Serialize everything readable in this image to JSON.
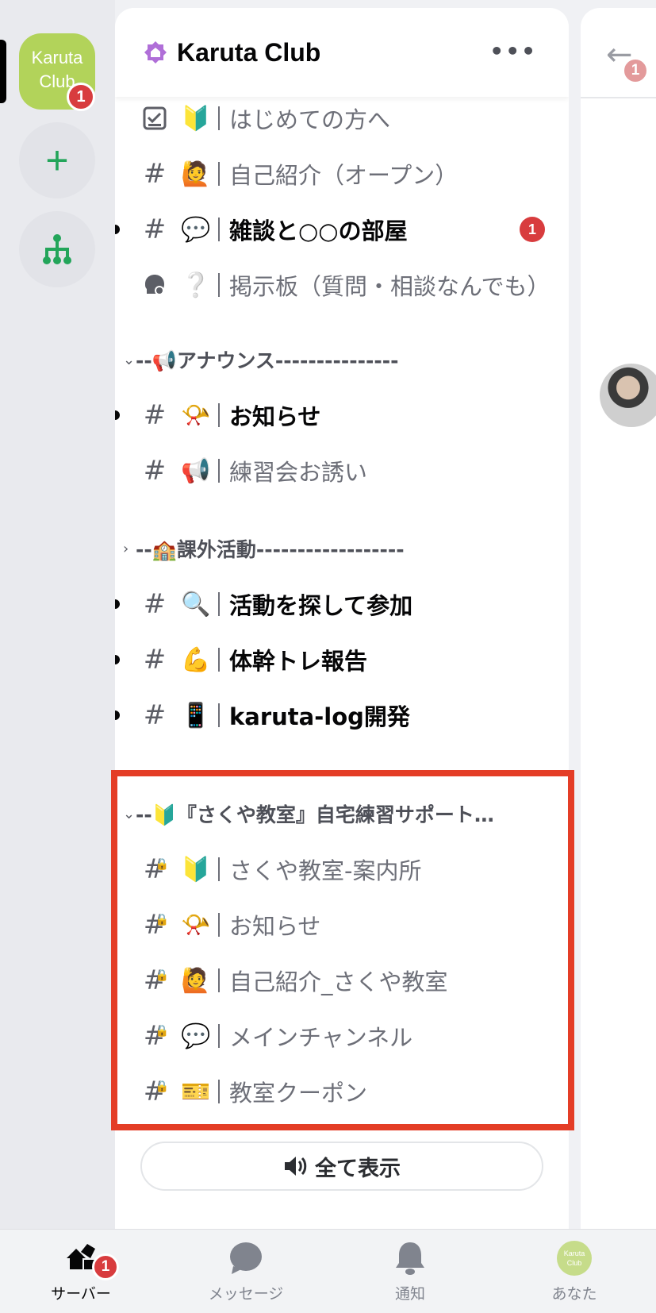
{
  "server_rail": {
    "server_icon_text": "Karuta Club",
    "server_badge": "1",
    "add_icon": "plus-icon",
    "directory_icon": "hub-icon"
  },
  "header": {
    "title": "Karuta Club",
    "more_label": "•••"
  },
  "channels_top": [
    {
      "icon": "checklist",
      "emoji": "🔰",
      "name": "はじめての方へ",
      "unread": false,
      "badge": ""
    },
    {
      "icon": "#",
      "emoji": "🙋",
      "name": "自己紹介（オープン）",
      "unread": false,
      "badge": ""
    },
    {
      "icon": "#",
      "emoji": "💬",
      "name": "雑談と○○の部屋",
      "unread": true,
      "badge": "1"
    },
    {
      "icon": "forum",
      "emoji": "❔",
      "name": "掲示板（質問・相談なんでも）",
      "unread": false,
      "badge": ""
    }
  ],
  "categories": [
    {
      "name": "--📢アナウンス---------------",
      "chevron": "⌄"
    },
    {
      "name": "--🏫課外活動------------------",
      "chevron": "›"
    },
    {
      "name": "--🔰『さくや教室』自宅練習サポートコミュニティ",
      "chevron": "⌄"
    }
  ],
  "announce_channels": [
    {
      "icon": "#",
      "emoji": "📯",
      "name": "お知らせ",
      "unread": true
    },
    {
      "icon": "#",
      "emoji": "📢",
      "name": "練習会お誘い",
      "unread": false
    }
  ],
  "activity_channels": [
    {
      "icon": "#",
      "emoji": "🔍",
      "name": "活動を探して参加",
      "unread": true
    },
    {
      "icon": "#",
      "emoji": "💪",
      "name": "体幹トレ報告",
      "unread": true
    },
    {
      "icon": "#",
      "emoji": "📱",
      "name": "karuta-log開発",
      "unread": true
    }
  ],
  "sakuya_channels": [
    {
      "icon": "#🔒",
      "emoji": "🔰",
      "name": "さくや教室-案内所"
    },
    {
      "icon": "#🔒",
      "emoji": "📯",
      "name": "お知らせ"
    },
    {
      "icon": "#🔒",
      "emoji": "🙋",
      "name": "自己紹介_さくや教室"
    },
    {
      "icon": "#🔒",
      "emoji": "💬",
      "name": "メインチャンネル"
    },
    {
      "icon": "#🔒",
      "emoji": "🎫",
      "name": "教室クーポン"
    }
  ],
  "show_all_label": "全て表示",
  "right_panel": {
    "back_badge": "1"
  },
  "bottom_nav": {
    "servers": {
      "label": "サーバー",
      "badge": "1"
    },
    "messages": {
      "label": "メッセージ"
    },
    "notifications": {
      "label": "通知"
    },
    "you": {
      "label": "あなた",
      "avatar_text": "Karuta Club"
    }
  },
  "colors": {
    "highlight": "#e43d26",
    "badge": "#d83c3e",
    "server_icon": "#b2d35a",
    "add_green": "#23a55a"
  }
}
